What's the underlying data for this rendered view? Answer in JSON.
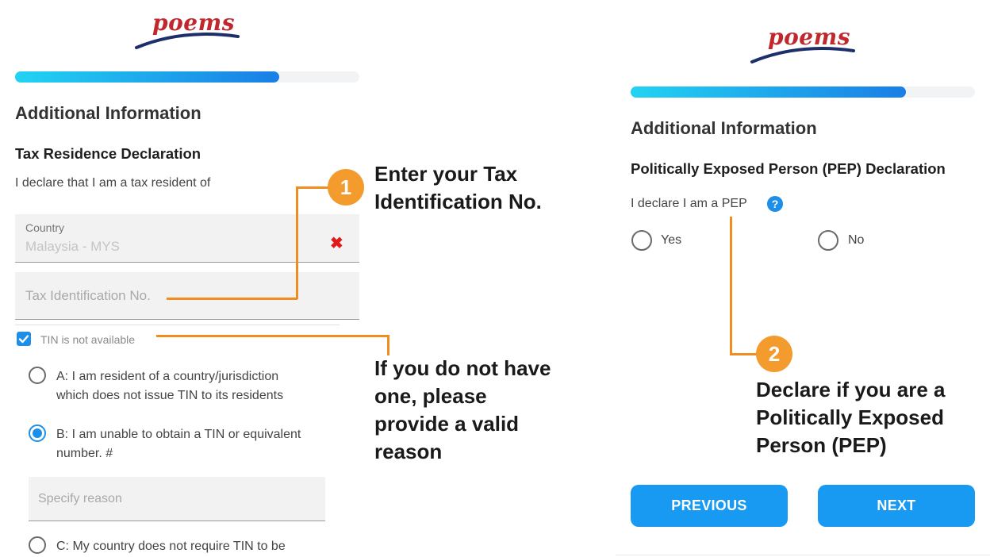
{
  "brand": {
    "logo": "poems"
  },
  "left": {
    "progress": 0.77,
    "title": "Additional Information",
    "section_title": "Tax Residence Declaration",
    "declare_text": "I declare that I am a tax resident of",
    "country_label": "Country",
    "country_value": "Malaysia - MYS",
    "clear_icon": "✖",
    "tin_placeholder": "Tax Identification No.",
    "tin_checkbox_label": "TIN is not available",
    "options": [
      {
        "label": "A: I am resident of a country/jurisdiction which does not issue TIN to its residents",
        "selected": false
      },
      {
        "label": "B: I am unable to obtain a TIN or equivalent number. #",
        "selected": true
      },
      {
        "label": "C: My country does not require TIN to be",
        "selected": false
      }
    ],
    "reason_placeholder": "Specify reason"
  },
  "right": {
    "progress": 0.8,
    "title": "Additional Information",
    "section_title": "Politically Exposed Person (PEP) Declaration",
    "declare_text": "I declare I am a PEP",
    "help_icon": "?",
    "yes_label": "Yes",
    "no_label": "No",
    "previous_label": "PREVIOUS",
    "next_label": "NEXT"
  },
  "annotations": {
    "step1_number": "1",
    "step1_line1": "Enter your Tax",
    "step1_line2": "Identification No.",
    "tin_note_line1": "If you do not have",
    "tin_note_line2": "one, please",
    "tin_note_line3": "provide a valid",
    "tin_note_line4": "reason",
    "step2_number": "2",
    "step2_line1": "Declare if you are a",
    "step2_line2": "Politically Exposed",
    "step2_line3": "Person (PEP)"
  },
  "colors": {
    "accent": "#1899f2",
    "annotation": "#f39b2d",
    "logo": "#c0282d"
  }
}
